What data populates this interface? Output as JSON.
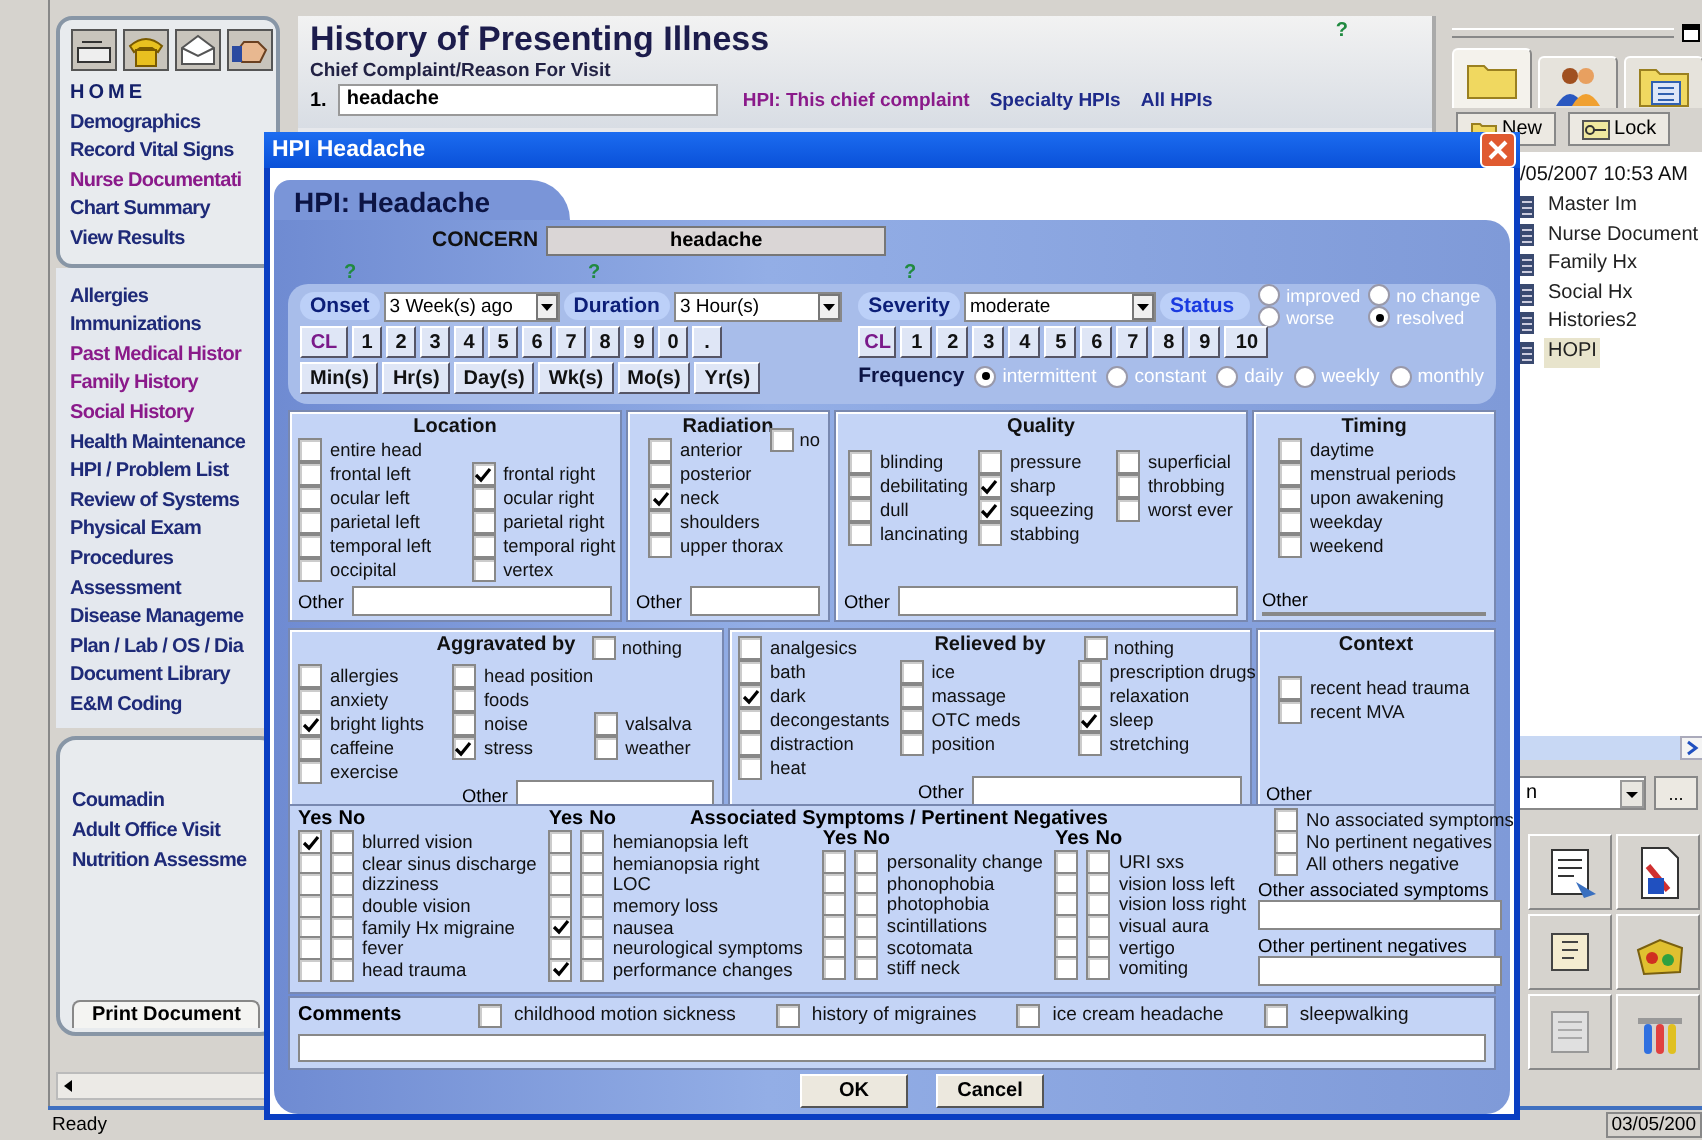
{
  "sidebar": {
    "groups": [
      {
        "items": [
          {
            "label": "HOME",
            "kind": "heading",
            "visited": false
          },
          {
            "label": "Demographics",
            "kind": "link",
            "visited": false
          },
          {
            "label": "Record Vital Signs",
            "kind": "link",
            "visited": false
          },
          {
            "label": "Nurse Documentati",
            "kind": "link",
            "visited": true
          },
          {
            "label": "Chart Summary",
            "kind": "link",
            "visited": false
          },
          {
            "label": "View Results",
            "kind": "link",
            "visited": false
          }
        ]
      },
      {
        "items": [
          {
            "label": "Allergies",
            "kind": "link",
            "visited": false
          },
          {
            "label": "Immunizations",
            "kind": "link",
            "visited": false
          },
          {
            "label": "Past Medical Histor",
            "kind": "link",
            "visited": true
          },
          {
            "label": "Family History",
            "kind": "link",
            "visited": true
          },
          {
            "label": "Social History",
            "kind": "link",
            "visited": true
          },
          {
            "label": "Health Maintenance",
            "kind": "link",
            "visited": false
          },
          {
            "label": "HPI / Problem List",
            "kind": "link",
            "visited": false
          },
          {
            "label": "Review of Systems",
            "kind": "link",
            "visited": false
          },
          {
            "label": "Physical Exam",
            "kind": "link",
            "visited": false
          },
          {
            "label": "Procedures",
            "kind": "link",
            "visited": false
          },
          {
            "label": "Assessment",
            "kind": "link",
            "visited": false
          },
          {
            "label": "Disease Manageme",
            "kind": "link",
            "visited": false
          },
          {
            "label": "Plan / Lab / OS / Dia",
            "kind": "link",
            "visited": false
          },
          {
            "label": "Document Library",
            "kind": "link",
            "visited": false
          },
          {
            "label": "E&M Coding",
            "kind": "link",
            "visited": false
          }
        ]
      },
      {
        "items": [
          {
            "label": "Coumadin",
            "kind": "link",
            "visited": false
          },
          {
            "label": "Adult Office Visit",
            "kind": "link",
            "visited": false
          },
          {
            "label": "Nutrition Assessme",
            "kind": "link",
            "visited": false
          }
        ]
      }
    ],
    "print_button": "Print Document"
  },
  "header": {
    "title": "History of Presenting Illness",
    "help": "?",
    "field_label": "Chief Complaint/Reason For Visit",
    "number": "1.",
    "complaint": "headache",
    "links": [
      {
        "label": "HPI: This chief complaint",
        "visited": true
      },
      {
        "label": "Specialty HPIs",
        "visited": false
      },
      {
        "label": "All HPIs",
        "visited": false
      }
    ]
  },
  "right_panel": {
    "tabs": [
      {
        "selected": true
      },
      {
        "selected": false
      },
      {
        "selected": false
      }
    ],
    "buttons": [
      "New",
      "Lock"
    ],
    "date": "/05/2007 10:53 AM",
    "documents": [
      {
        "label": "Master Im",
        "selected": false
      },
      {
        "label": "Nurse Document",
        "selected": false
      },
      {
        "label": "Family Hx",
        "selected": false
      },
      {
        "label": "Social Hx",
        "selected": false
      },
      {
        "label": "Histories2",
        "selected": false
      },
      {
        "label": "HOPI",
        "selected": true
      }
    ],
    "dropdown": "n",
    "more_button": "...",
    "status_date": "03/05/200"
  },
  "status_bar": "Ready",
  "dialog": {
    "title": "HPI Headache",
    "tab": "HPI: Headache",
    "concern_label": "CONCERN",
    "concern": "headache",
    "onset": {
      "help": "?",
      "label": "Onset",
      "value": "3 Week(s) ago"
    },
    "duration": {
      "help": "?",
      "label": "Duration",
      "value": "3 Hour(s)"
    },
    "time_keys": [
      "CL",
      "1",
      "2",
      "3",
      "4",
      "5",
      "6",
      "7",
      "8",
      "9",
      "0",
      "."
    ],
    "unit_keys": [
      "Min(s)",
      "Hr(s)",
      "Day(s)",
      "Wk(s)",
      "Mo(s)",
      "Yr(s)"
    ],
    "severity": {
      "help": "?",
      "label": "Severity",
      "value": "moderate"
    },
    "status": {
      "label": "Status",
      "options": [
        {
          "label": "improved",
          "selected": false
        },
        {
          "label": "no change",
          "selected": false
        },
        {
          "label": "worse",
          "selected": false
        },
        {
          "label": "resolved",
          "selected": true
        }
      ]
    },
    "severity_keys": [
      "CL",
      "1",
      "2",
      "3",
      "4",
      "5",
      "6",
      "7",
      "8",
      "9",
      "10"
    ],
    "frequency": {
      "label": "Frequency",
      "options": [
        {
          "label": "intermittent",
          "selected": true
        },
        {
          "label": "constant",
          "selected": false
        },
        {
          "label": "daily",
          "selected": false
        },
        {
          "label": "weekly",
          "selected": false
        },
        {
          "label": "monthly",
          "selected": false
        }
      ]
    },
    "sections": [
      {
        "title": "Location",
        "columns": [
          [
            {
              "label": "entire head",
              "checked": false
            },
            {
              "label": "frontal left",
              "checked": false
            },
            {
              "label": "ocular left",
              "checked": false
            },
            {
              "label": "parietal left",
              "checked": false
            },
            {
              "label": "temporal left",
              "checked": false
            },
            {
              "label": "occipital",
              "checked": false
            }
          ],
          [
            {
              "label": "frontal right",
              "checked": true
            },
            {
              "label": "ocular right",
              "checked": false
            },
            {
              "label": "parietal right",
              "checked": false
            },
            {
              "label": "temporal right",
              "checked": false
            },
            {
              "label": "vertex",
              "checked": false
            }
          ]
        ],
        "other_label": "Other"
      },
      {
        "title": "Radiation",
        "none_option": {
          "label": "no",
          "checked": false
        },
        "columns": [
          [
            {
              "label": "anterior",
              "checked": false
            },
            {
              "label": "posterior",
              "checked": false
            },
            {
              "label": "neck",
              "checked": true
            },
            {
              "label": "shoulders",
              "checked": false
            },
            {
              "label": "upper thorax",
              "checked": false
            }
          ]
        ],
        "other_label": "Other"
      },
      {
        "title": "Quality",
        "columns": [
          [
            {
              "label": "blinding",
              "checked": false
            },
            {
              "label": "debilitating",
              "checked": false
            },
            {
              "label": "dull",
              "checked": false
            },
            {
              "label": "lancinating",
              "checked": false
            }
          ],
          [
            {
              "label": "pressure",
              "checked": false
            },
            {
              "label": "sharp",
              "checked": true
            },
            {
              "label": "squeezing",
              "checked": true
            },
            {
              "label": "stabbing",
              "checked": false
            }
          ],
          [
            {
              "label": "superficial",
              "checked": false
            },
            {
              "label": "throbbing",
              "checked": false
            },
            {
              "label": "worst ever",
              "checked": false
            }
          ]
        ],
        "other_label": "Other"
      },
      {
        "title": "Timing",
        "columns": [
          [
            {
              "label": "daytime",
              "checked": false
            },
            {
              "label": "menstrual periods",
              "checked": false
            },
            {
              "label": "upon awakening",
              "checked": false
            },
            {
              "label": "weekday",
              "checked": false
            },
            {
              "label": "weekend",
              "checked": false
            }
          ]
        ],
        "other_label": "Other"
      },
      {
        "title": "Aggravated by",
        "none_option": {
          "label": "nothing",
          "checked": false
        },
        "columns": [
          [
            {
              "label": "allergies",
              "checked": false
            },
            {
              "label": "anxiety",
              "checked": false
            },
            {
              "label": "bright lights",
              "checked": true
            },
            {
              "label": "caffeine",
              "checked": false
            },
            {
              "label": "exercise",
              "checked": false
            }
          ],
          [
            {
              "label": "head position",
              "checked": false
            },
            {
              "label": "foods",
              "checked": false
            },
            {
              "label": "noise",
              "checked": false
            },
            {
              "label": "stress",
              "checked": true
            }
          ],
          [
            {
              "label": "valsalva",
              "checked": false
            },
            {
              "label": "weather",
              "checked": false
            }
          ]
        ],
        "other_label": "Other"
      },
      {
        "title": "Relieved by",
        "none_option": {
          "label": "nothing",
          "checked": false
        },
        "columns": [
          [
            {
              "label": "analgesics",
              "checked": false
            },
            {
              "label": "bath",
              "checked": false
            },
            {
              "label": "dark",
              "checked": true
            },
            {
              "label": "decongestants",
              "checked": false
            },
            {
              "label": "distraction",
              "checked": false
            },
            {
              "label": "heat",
              "checked": false
            }
          ],
          [
            {
              "label": "ice",
              "checked": false
            },
            {
              "label": "massage",
              "checked": false
            },
            {
              "label": "OTC meds",
              "checked": false
            },
            {
              "label": "position",
              "checked": false
            }
          ],
          [
            {
              "label": "prescription drugs",
              "checked": false
            },
            {
              "label": "relaxation",
              "checked": false
            },
            {
              "label": "sleep",
              "checked": true
            },
            {
              "label": "stretching",
              "checked": false
            }
          ]
        ],
        "other_label": "Other"
      },
      {
        "title": "Context",
        "columns": [
          [
            {
              "label": "recent head trauma",
              "checked": false
            },
            {
              "label": "recent MVA",
              "checked": false
            }
          ]
        ],
        "other_label": "Other"
      }
    ],
    "associated": {
      "title": "Associated Symptoms / Pertinent Negatives",
      "columns": [
        {
          "yes_label": "Yes",
          "no_label": "No",
          "items": [
            {
              "label": "blurred vision",
              "yes": true,
              "no": false
            },
            {
              "label": "clear sinus discharge",
              "yes": false,
              "no": false
            },
            {
              "label": "dizziness",
              "yes": false,
              "no": false
            },
            {
              "label": "double vision",
              "yes": false,
              "no": false
            },
            {
              "label": "family Hx migraine",
              "yes": false,
              "no": false
            },
            {
              "label": "fever",
              "yes": false,
              "no": false
            },
            {
              "label": "head trauma",
              "yes": false,
              "no": false
            }
          ]
        },
        {
          "yes_label": "Yes",
          "no_label": "No",
          "items": [
            {
              "label": "hemianopsia left",
              "yes": false,
              "no": false
            },
            {
              "label": "hemianopsia right",
              "yes": false,
              "no": false
            },
            {
              "label": "LOC",
              "yes": false,
              "no": false
            },
            {
              "label": "memory loss",
              "yes": false,
              "no": false
            },
            {
              "label": "nausea",
              "yes": true,
              "no": false
            },
            {
              "label": "neurological symptoms",
              "yes": false,
              "no": false
            },
            {
              "label": "performance changes",
              "yes": true,
              "no": false
            }
          ]
        },
        {
          "yes_label": "Yes",
          "no_label": "No",
          "items": [
            {
              "label": "personality change",
              "yes": false,
              "no": false
            },
            {
              "label": "phonophobia",
              "yes": false,
              "no": false
            },
            {
              "label": "photophobia",
              "yes": false,
              "no": false
            },
            {
              "label": "scintillations",
              "yes": false,
              "no": false
            },
            {
              "label": "scotomata",
              "yes": false,
              "no": false
            },
            {
              "label": "stiff neck",
              "yes": false,
              "no": false
            }
          ]
        },
        {
          "yes_label": "Yes",
          "no_label": "No",
          "items": [
            {
              "label": "URI sxs",
              "yes": false,
              "no": false
            },
            {
              "label": "vision loss left",
              "yes": false,
              "no": false
            },
            {
              "label": "vision loss right",
              "yes": false,
              "no": false
            },
            {
              "label": "visual aura",
              "yes": false,
              "no": false
            },
            {
              "label": "vertigo",
              "yes": false,
              "no": false
            },
            {
              "label": "vomiting",
              "yes": false,
              "no": false
            }
          ]
        }
      ],
      "flags": [
        {
          "label": "No associated symptoms",
          "checked": false
        },
        {
          "label": "No pertinent negatives",
          "checked": false
        },
        {
          "label": "All others negative",
          "checked": false
        }
      ],
      "other_fields": [
        "Other associated symptoms",
        "Other pertinent negatives"
      ]
    },
    "comments": {
      "label": "Comments",
      "options": [
        {
          "label": "childhood motion sickness",
          "checked": false
        },
        {
          "label": "history of migraines",
          "checked": false
        },
        {
          "label": "ice cream headache",
          "checked": false
        },
        {
          "label": "sleepwalking",
          "checked": false
        }
      ]
    },
    "buttons": [
      "OK",
      "Cancel"
    ]
  }
}
